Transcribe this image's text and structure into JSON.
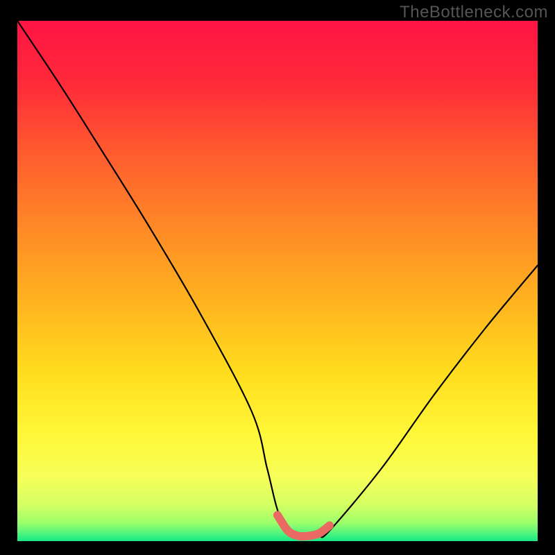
{
  "watermark": "TheBottleneck.com",
  "chart_data": {
    "type": "line",
    "title": "",
    "xlabel": "",
    "ylabel": "",
    "xlim": [
      0,
      100
    ],
    "ylim": [
      0,
      100
    ],
    "series": [
      {
        "name": "bottleneck-curve",
        "x": [
          0,
          8,
          15,
          25,
          35,
          45,
          48,
          50,
          52,
          56,
          58,
          60,
          70,
          80,
          90,
          100
        ],
        "y": [
          100,
          88,
          77,
          61,
          44,
          25,
          14,
          6,
          2,
          1,
          1,
          2,
          14,
          28,
          41,
          53
        ]
      },
      {
        "name": "optimal-zone",
        "x": [
          50,
          52,
          54,
          56,
          58,
          60
        ],
        "y": [
          5,
          2,
          1,
          1,
          1.5,
          3
        ]
      }
    ],
    "gradient_stops": [
      {
        "offset": 0.0,
        "color": "#ff1444"
      },
      {
        "offset": 0.12,
        "color": "#ff2a3a"
      },
      {
        "offset": 0.25,
        "color": "#ff5a2f"
      },
      {
        "offset": 0.4,
        "color": "#ff8a26"
      },
      {
        "offset": 0.55,
        "color": "#ffb61f"
      },
      {
        "offset": 0.68,
        "color": "#ffde1e"
      },
      {
        "offset": 0.8,
        "color": "#fff83a"
      },
      {
        "offset": 0.88,
        "color": "#f6ff5a"
      },
      {
        "offset": 0.93,
        "color": "#d4ff63"
      },
      {
        "offset": 0.965,
        "color": "#9cff6a"
      },
      {
        "offset": 0.985,
        "color": "#50f57e"
      },
      {
        "offset": 1.0,
        "color": "#18e886"
      }
    ],
    "curve_color": "#000000",
    "optimal_color": "#e96a62"
  }
}
